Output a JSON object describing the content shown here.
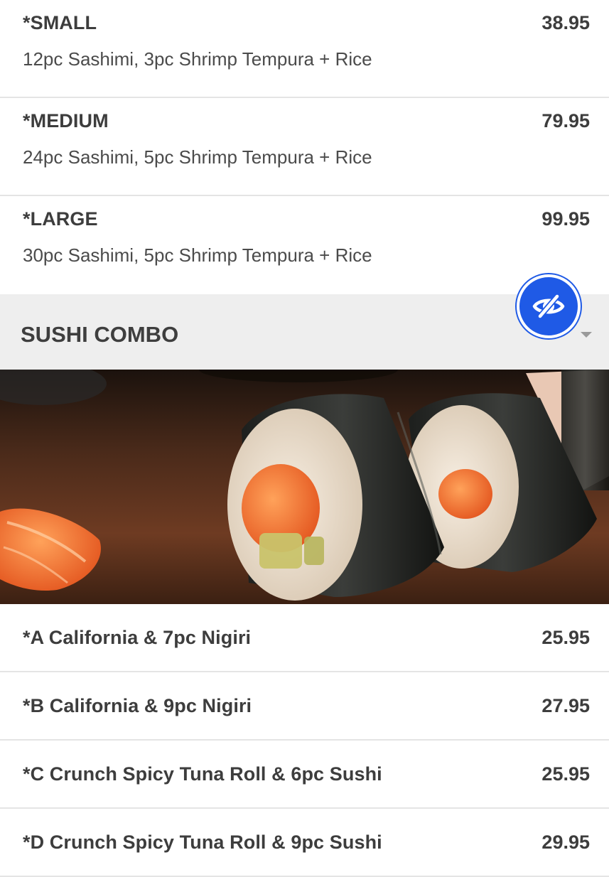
{
  "platters": [
    {
      "name": "*SMALL",
      "price": "38.95",
      "description": "12pc Sashimi, 3pc Shrimp Tempura + Rice"
    },
    {
      "name": "*MEDIUM",
      "price": "79.95",
      "description": "24pc Sashimi, 5pc Shrimp Tempura + Rice"
    },
    {
      "name": "*LARGE",
      "price": "99.95",
      "description": "30pc Sashimi, 5pc Shrimp Tempura + Rice"
    }
  ],
  "section": {
    "title": "SUSHI COMBO"
  },
  "icons": {
    "accessibility_button": "eye-slash-icon",
    "collapse": "caret-down-icon"
  },
  "colors": {
    "accent": "#1f5ae6",
    "header_bg": "#eeeeee",
    "divider": "#e4e4e4"
  },
  "combos": [
    {
      "name": "*A California & 7pc Nigiri",
      "price": "25.95"
    },
    {
      "name": "*B California & 9pc Nigiri",
      "price": "27.95"
    },
    {
      "name": "*C Crunch Spicy Tuna Roll & 6pc Sushi",
      "price": "25.95"
    },
    {
      "name": "*D Crunch Spicy Tuna Roll & 9pc Sushi",
      "price": "29.95"
    }
  ]
}
